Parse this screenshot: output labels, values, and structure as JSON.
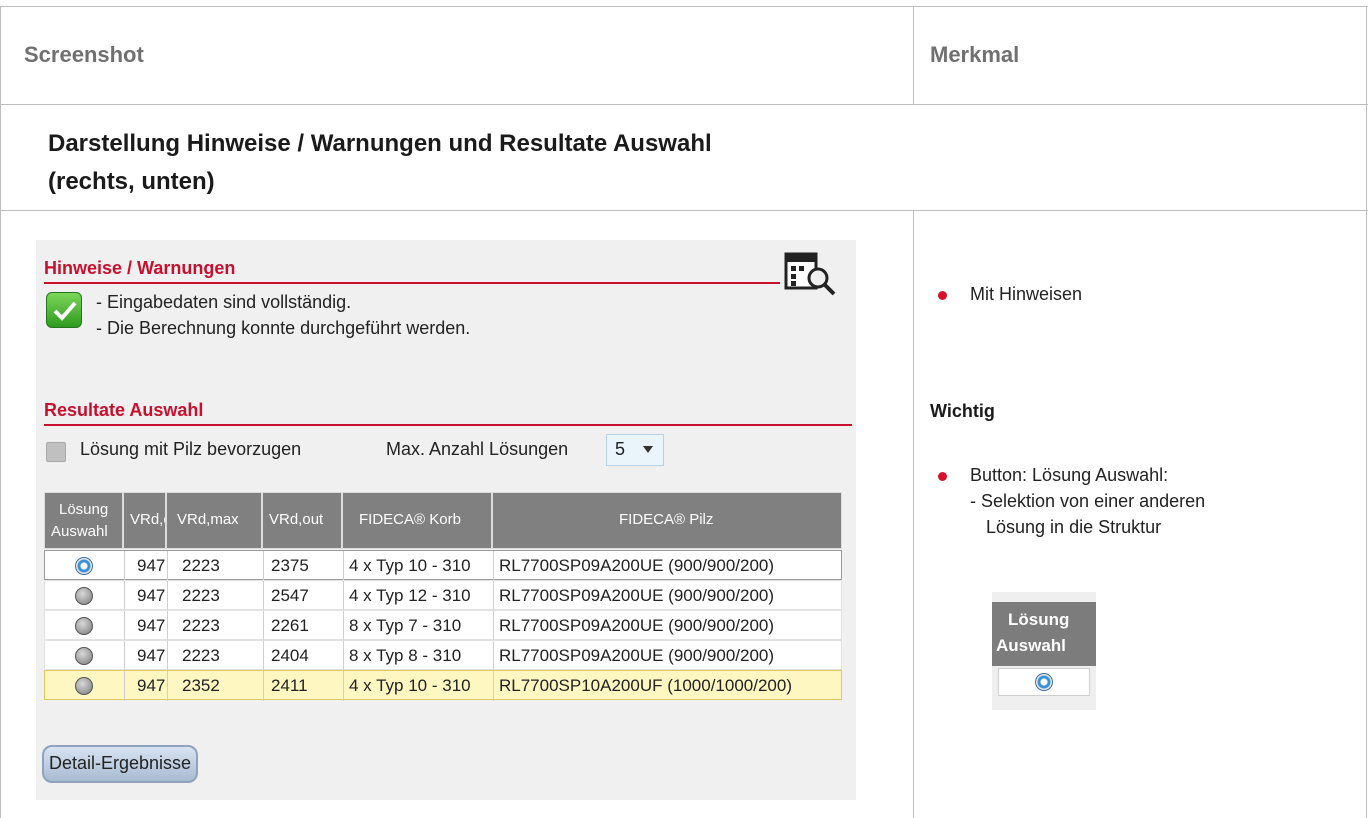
{
  "header": {
    "col1": "Screenshot",
    "col2": "Merkmal"
  },
  "section": {
    "title_line1": "Darstellung Hinweise / Warnungen und Resultate Auswahl",
    "title_line2": "(rechts, unten)"
  },
  "panel": {
    "hinweise_title": "Hinweise / Warnungen",
    "messages": [
      "- Eingabedaten sind vollständig.",
      "- Die Berechnung konnte durchgeführt werden."
    ],
    "resultate_title": "Resultate Auswahl",
    "prefer_label": "Lösung mit Pilz bevorzugen",
    "max_label": "Max. Anzahl Lösungen",
    "max_value": "5",
    "detail_button": "Detail-Ergebnisse",
    "columns": {
      "auswahl_line1": "Lösung",
      "auswahl_line2": "Auswahl",
      "vrd_c": "VRd,c",
      "vrd_max": "VRd,max",
      "vrd_out": "VRd,out",
      "korb": "FIDECA® Korb",
      "pilz": "FIDECA® Pilz"
    },
    "rows": [
      {
        "vrd_c": "947",
        "vrd_max": "2223",
        "vrd_out": "2375",
        "korb": "4 x Typ 10 - 310",
        "pilz": "RL7700SP09A200UE (900/900/200)",
        "selected": true
      },
      {
        "vrd_c": "947",
        "vrd_max": "2223",
        "vrd_out": "2547",
        "korb": "4 x Typ 12 - 310",
        "pilz": "RL7700SP09A200UE (900/900/200)",
        "selected": false
      },
      {
        "vrd_c": "947",
        "vrd_max": "2223",
        "vrd_out": "2261",
        "korb": "8 x Typ 7 - 310",
        "pilz": "RL7700SP09A200UE (900/900/200)",
        "selected": false
      },
      {
        "vrd_c": "947",
        "vrd_max": "2223",
        "vrd_out": "2404",
        "korb": "8 x Typ 8 - 310",
        "pilz": "RL7700SP09A200UE (900/900/200)",
        "selected": false
      },
      {
        "vrd_c": "947",
        "vrd_max": "2352",
        "vrd_out": "2411",
        "korb": "4 x Typ 10 - 310",
        "pilz": "RL7700SP10A200UF (1000/1000/200)",
        "selected": false
      }
    ],
    "highlight_color": "#fff7c2"
  },
  "merkmal": {
    "item1": "Mit Hinweisen",
    "wichtig": "Wichtig",
    "item2_line1": "Button: Lösung Auswahl:",
    "item2_line2": "- Selektion von einer anderen",
    "item2_line3": "Lösung in die Struktur",
    "mini_line1": "Lösung",
    "mini_line2": "Auswahl"
  },
  "colors": {
    "accent_red": "#c8102e",
    "bullet_red": "#d6112a"
  }
}
